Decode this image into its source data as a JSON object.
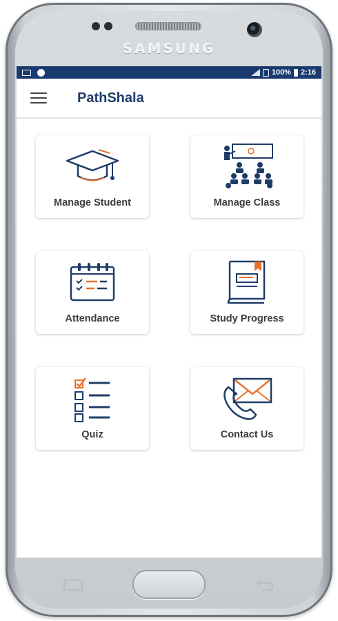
{
  "device": {
    "brand": "SAMSUNG"
  },
  "status_bar": {
    "battery": "100%",
    "time": "2:16"
  },
  "app_bar": {
    "title": "PathShala"
  },
  "menu": [
    {
      "label": "Manage Student",
      "icon": "graduation-cap-icon"
    },
    {
      "label": "Manage Class",
      "icon": "classroom-icon"
    },
    {
      "label": "Attendance",
      "icon": "calendar-icon"
    },
    {
      "label": "Study Progress",
      "icon": "book-icon"
    },
    {
      "label": "Quiz",
      "icon": "checklist-icon"
    },
    {
      "label": "Contact Us",
      "icon": "phone-mail-icon"
    }
  ],
  "colors": {
    "primary": "#1f3c68",
    "status_bar": "#183a6e",
    "accent": "#e8712c"
  }
}
